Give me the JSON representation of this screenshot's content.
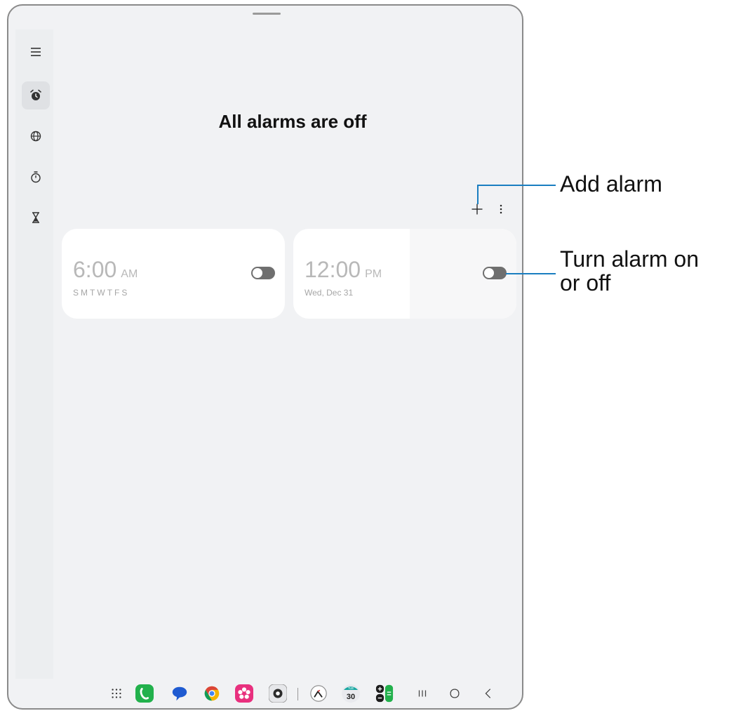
{
  "headline": "All alarms are off",
  "alarms": [
    {
      "time": "6:00",
      "ampm": "AM",
      "days": [
        "S",
        "M",
        "T",
        "W",
        "T",
        "F",
        "S"
      ],
      "enabled": false
    },
    {
      "time": "12:00",
      "ampm": "PM",
      "date": "Wed, Dec 31",
      "enabled": false
    }
  ],
  "callouts": {
    "add_alarm": "Add alarm",
    "toggle_line1": "Turn alarm on",
    "toggle_line2": "or off"
  },
  "dock": {
    "calendar_day": "TUE",
    "calendar_date": "30"
  },
  "colors": {
    "callout_line": "#1a7ec0",
    "phone": "#22b14c",
    "messages": "#1f5bd1",
    "gallery": "#e8307e"
  }
}
